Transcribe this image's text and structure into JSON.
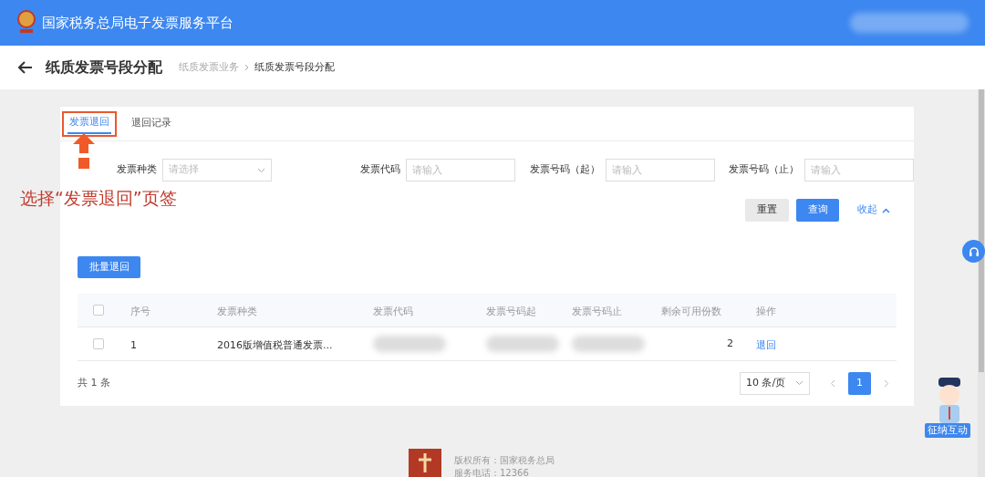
{
  "header": {
    "title": "国家税务总局电子发票服务平台"
  },
  "page": {
    "title": "纸质发票号段分配",
    "breadcrumb": [
      {
        "label": "纸质发票业务",
        "current": false
      },
      {
        "label": "纸质发票号段分配",
        "current": true
      }
    ]
  },
  "tabs": [
    {
      "label": "发票退回",
      "selected": true,
      "highlighted": true
    },
    {
      "label": "退回记录",
      "selected": false,
      "highlighted": false
    }
  ],
  "annotation": {
    "text": "选择“发票退回”页签"
  },
  "filters": [
    {
      "label": "发票种类",
      "kind": "select",
      "placeholder": "请选择"
    },
    {
      "label": "发票代码",
      "kind": "input",
      "placeholder": "请输入"
    },
    {
      "label": "发票号码（起）",
      "kind": "input",
      "placeholder": "请输入"
    },
    {
      "label": "发票号码（止）",
      "kind": "input",
      "placeholder": "请输入"
    }
  ],
  "actions": {
    "reset": "重置",
    "search": "查询",
    "collapse": "收起"
  },
  "batch_button": "批量退回",
  "table": {
    "header_checked": false,
    "columns": [
      "序号",
      "发票种类",
      "发票代码",
      "发票号码起",
      "发票号码止",
      "剩余可用份数",
      "操作"
    ],
    "rows": [
      {
        "checked": false,
        "cells": [
          {
            "kind": "text",
            "text": "1"
          },
          {
            "kind": "text",
            "text": "2016版增值税普通发票..."
          },
          {
            "kind": "blurred"
          },
          {
            "kind": "blurred"
          },
          {
            "kind": "blurred"
          },
          {
            "kind": "number",
            "text": "2"
          },
          {
            "kind": "link",
            "text": "退回"
          }
        ]
      }
    ]
  },
  "footer": {
    "total": "共 1 条",
    "page_size": "10 条/页",
    "pages": [
      {
        "label": "1",
        "selected": true
      }
    ]
  },
  "assistant": {
    "label": "征纳互动"
  },
  "site_footer": [
    "版权所有：国家税务总局",
    "服务电话：12366"
  ]
}
